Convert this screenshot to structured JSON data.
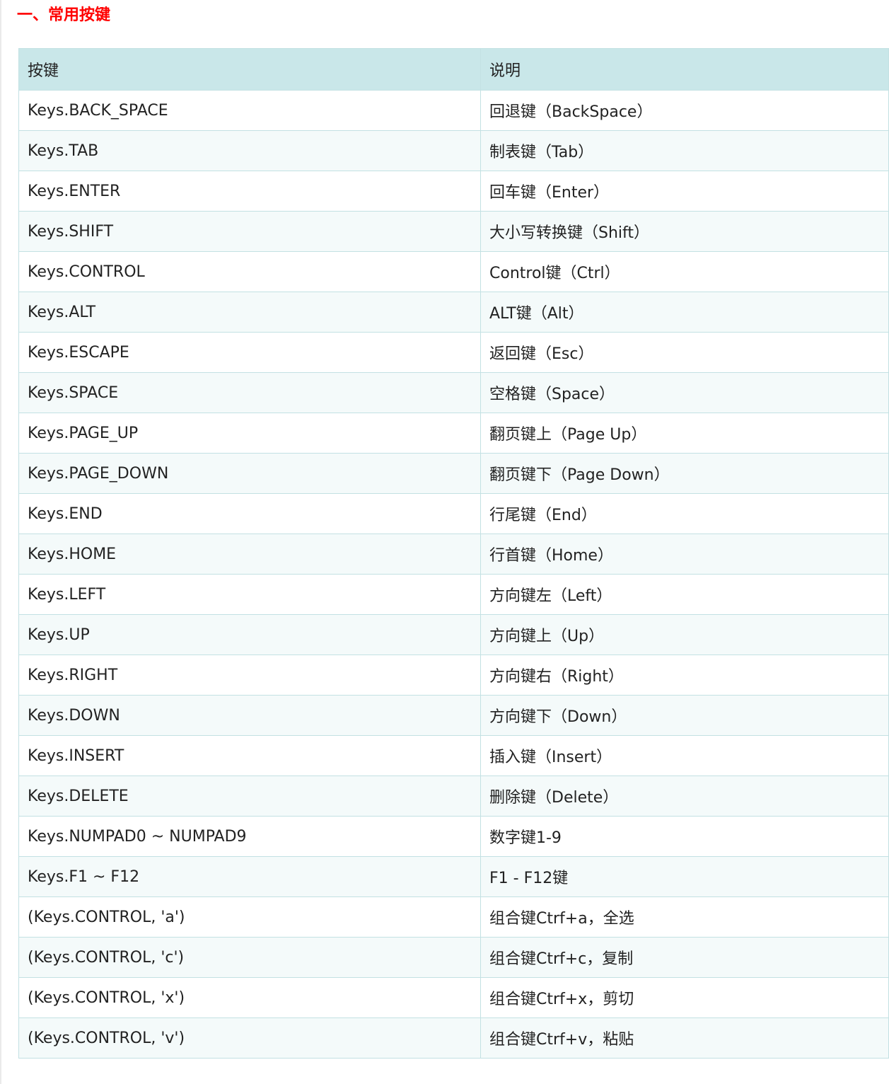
{
  "section_title": "一、常用按键",
  "table": {
    "headers": [
      "按键",
      "说明"
    ],
    "rows": [
      [
        "Keys.BACK_SPACE",
        "回退键（BackSpace）"
      ],
      [
        "Keys.TAB",
        "制表键（Tab）"
      ],
      [
        "Keys.ENTER",
        "回车键（Enter）"
      ],
      [
        "Keys.SHIFT",
        "大小写转换键（Shift）"
      ],
      [
        "Keys.CONTROL",
        "Control键（Ctrl）"
      ],
      [
        "Keys.ALT",
        "ALT键（Alt）"
      ],
      [
        "Keys.ESCAPE",
        "返回键（Esc）"
      ],
      [
        "Keys.SPACE",
        "空格键（Space）"
      ],
      [
        "Keys.PAGE_UP",
        "翻页键上（Page Up）"
      ],
      [
        "Keys.PAGE_DOWN",
        "翻页键下（Page Down）"
      ],
      [
        "Keys.END",
        "行尾键（End）"
      ],
      [
        "Keys.HOME",
        "行首键（Home）"
      ],
      [
        "Keys.LEFT",
        "方向键左（Left）"
      ],
      [
        "Keys.UP",
        "方向键上（Up）"
      ],
      [
        "Keys.RIGHT",
        "方向键右（Right）"
      ],
      [
        "Keys.DOWN",
        "方向键下（Down）"
      ],
      [
        "Keys.INSERT",
        "插入键（Insert）"
      ],
      [
        "Keys.DELETE",
        "删除键（Delete）"
      ],
      [
        "Keys.NUMPAD0 ~ NUMPAD9",
        "数字键1-9"
      ],
      [
        "Keys.F1 ~ F12",
        "F1 - F12键"
      ],
      [
        "(Keys.CONTROL, 'a')",
        "组合键Ctrf+a，全选"
      ],
      [
        "(Keys.CONTROL, 'c')",
        "组合键Ctrf+c，复制"
      ],
      [
        "(Keys.CONTROL, 'x')",
        "组合键Ctrf+x，剪切"
      ],
      [
        "(Keys.CONTROL, 'v')",
        "组合键Ctrf+v，粘贴"
      ]
    ]
  },
  "colors": {
    "title": "#ff0000",
    "header_bg": "#c9e7e9",
    "border": "#c3e1e3",
    "stripe_bg": "#f4fafa"
  }
}
